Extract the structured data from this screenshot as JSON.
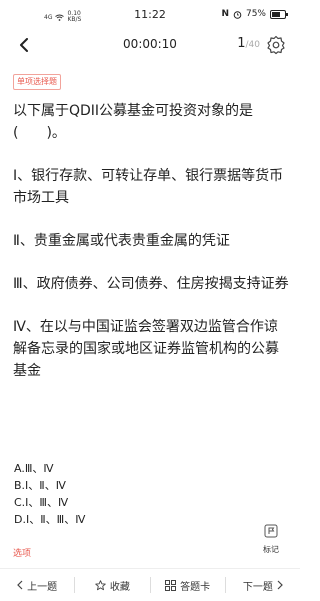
{
  "status_bar": {
    "network": "4G",
    "speed": "0.10",
    "speed_unit": "KB/S",
    "time": "11:22",
    "battery": "75%"
  },
  "nav": {
    "timer": "00:00:10",
    "page_current": "1",
    "page_total": "/40"
  },
  "question": {
    "type_label": "单项选择题",
    "stem": "以下属于QDII公募基金可投资对象的是(　　)。",
    "items": [
      "Ⅰ、银行存款、可转让存单、银行票据等货币市场工具",
      "Ⅱ、贵重金属或代表贵重金属的凭证",
      "Ⅲ、政府债券、公司债券、住房按揭支持证券",
      "Ⅳ、在以与中国证监会签署双边监管合作谅解备忘录的国家或地区证券监管机构的公募基金"
    ],
    "options": [
      "A.Ⅲ、Ⅳ",
      "B.Ⅰ、Ⅱ、Ⅳ",
      "C.Ⅰ、Ⅲ、Ⅳ",
      "D.Ⅰ、Ⅱ、Ⅲ、Ⅳ"
    ]
  },
  "mark_label": "标记",
  "options_tab": "选项",
  "bottom_bar": {
    "prev": "上一题",
    "favorite": "收藏",
    "answer_card": "答题卡",
    "next": "下一题"
  }
}
